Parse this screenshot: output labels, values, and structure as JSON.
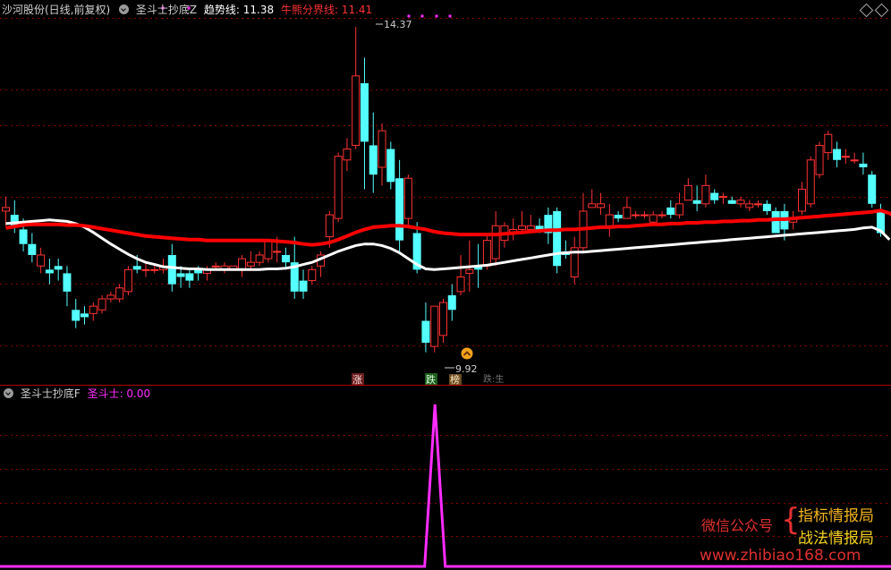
{
  "main_header": {
    "stock": "沙河股份(日线,前复权)",
    "indicator": "圣斗士抄底Z",
    "trend_label": "趋势线: 11.38",
    "bull_bear_label": "牛熊分界线: 11.41"
  },
  "sub_header": {
    "indicator": "圣斗士抄底F",
    "value_label": "圣斗士: 0.00"
  },
  "markers": {
    "high_label": "14.37",
    "low_label": "9.92",
    "rise_badge": "涨",
    "fall_badge": "跌",
    "bang_badge": "榜",
    "fall_badge_partial": "跌:生"
  },
  "watermark": {
    "line1": "微信公众号",
    "line2": "指标情报局",
    "line3": "战法情报局",
    "url": "www.zhibiao168.com"
  },
  "colors": {
    "up": "#ff3232",
    "down": "#54ffff",
    "trend": "#ffffff",
    "bull_bear": "#ff0000",
    "signal": "#ff2cff",
    "grid": "#8b0000",
    "header_text": "#d0d0d0"
  },
  "chart_data": [
    {
      "type": "candlestick",
      "title": "沙河股份(日线,前复权)",
      "series": [
        {
          "name": "趋势线",
          "last_value": 11.38
        },
        {
          "name": "牛熊分界线",
          "last_value": 11.41
        }
      ],
      "annotations": [
        {
          "label": "14.37",
          "kind": "high"
        },
        {
          "label": "9.92",
          "kind": "low"
        }
      ],
      "ohlc": [
        [
          11.85,
          12.05,
          11.65,
          11.9
        ],
        [
          11.8,
          12.0,
          11.55,
          11.63
        ],
        [
          11.6,
          11.75,
          11.3,
          11.4
        ],
        [
          11.4,
          11.55,
          11.15,
          11.25
        ],
        [
          11.1,
          11.35,
          11.0,
          11.25
        ],
        [
          11.05,
          11.2,
          10.85,
          11.0
        ],
        [
          11.1,
          11.2,
          10.9,
          11.05
        ],
        [
          11.0,
          11.1,
          10.55,
          10.75
        ],
        [
          10.5,
          10.65,
          10.25,
          10.35
        ],
        [
          10.45,
          10.55,
          10.3,
          10.4
        ],
        [
          10.45,
          10.6,
          10.35,
          10.55
        ],
        [
          10.5,
          10.7,
          10.45,
          10.65
        ],
        [
          10.65,
          10.75,
          10.6,
          10.7
        ],
        [
          10.65,
          10.85,
          10.6,
          10.8
        ],
        [
          10.75,
          11.1,
          10.7,
          11.05
        ],
        [
          11.1,
          11.25,
          11.0,
          11.05
        ],
        [
          11.05,
          11.15,
          10.95,
          11.05
        ],
        [
          11.05,
          11.1,
          11.0,
          11.05
        ],
        [
          11.05,
          11.2,
          11.0,
          11.1
        ],
        [
          11.25,
          11.4,
          10.75,
          10.85
        ],
        [
          11.0,
          11.1,
          10.8,
          10.95
        ],
        [
          11.0,
          11.05,
          10.8,
          10.9
        ],
        [
          11.05,
          11.1,
          10.9,
          11.0
        ],
        [
          11.0,
          11.1,
          10.9,
          11.05
        ],
        [
          11.1,
          11.15,
          11.05,
          11.1
        ],
        [
          11.05,
          11.15,
          11.0,
          11.1
        ],
        [
          11.05,
          11.1,
          11.05,
          11.1
        ],
        [
          11.05,
          11.25,
          10.95,
          11.2
        ],
        [
          11.1,
          11.3,
          11.05,
          11.15
        ],
        [
          11.15,
          11.3,
          11.1,
          11.25
        ],
        [
          11.2,
          11.45,
          11.15,
          11.45
        ],
        [
          11.3,
          11.5,
          11.15,
          11.3
        ],
        [
          11.25,
          11.35,
          11.05,
          11.15
        ],
        [
          11.15,
          11.5,
          10.65,
          10.75
        ],
        [
          10.9,
          11.05,
          10.65,
          10.75
        ],
        [
          10.9,
          11.1,
          10.85,
          11.05
        ],
        [
          11.1,
          11.3,
          10.95,
          11.25
        ],
        [
          11.5,
          11.85,
          11.35,
          11.8
        ],
        [
          11.75,
          12.65,
          11.7,
          12.6
        ],
        [
          12.55,
          12.85,
          12.4,
          12.7
        ],
        [
          12.75,
          14.37,
          12.7,
          13.7
        ],
        [
          13.6,
          13.95,
          12.15,
          12.8
        ],
        [
          12.75,
          13.2,
          12.1,
          12.35
        ],
        [
          12.45,
          13.05,
          12.2,
          12.95
        ],
        [
          12.7,
          12.8,
          12.15,
          12.25
        ],
        [
          12.3,
          12.55,
          11.3,
          11.45
        ],
        [
          11.75,
          12.35,
          11.65,
          12.3
        ],
        [
          11.55,
          11.7,
          11.0,
          11.05
        ],
        [
          10.35,
          10.6,
          9.92,
          10.05
        ],
        [
          10.0,
          10.55,
          9.92,
          10.55
        ],
        [
          10.15,
          10.65,
          10.05,
          10.6
        ],
        [
          10.7,
          10.85,
          10.35,
          10.5
        ],
        [
          10.75,
          11.25,
          10.7,
          10.95
        ],
        [
          11.0,
          11.45,
          10.75,
          11.05
        ],
        [
          11.1,
          11.4,
          10.8,
          11.05
        ],
        [
          11.1,
          11.55,
          11.05,
          11.45
        ],
        [
          11.2,
          11.85,
          11.1,
          11.65
        ],
        [
          11.45,
          11.7,
          11.35,
          11.65
        ],
        [
          11.55,
          11.75,
          11.45,
          11.6
        ],
        [
          11.6,
          11.85,
          11.55,
          11.65
        ],
        [
          11.6,
          11.8,
          11.55,
          11.65
        ],
        [
          11.65,
          11.75,
          11.55,
          11.6
        ],
        [
          11.8,
          11.9,
          11.4,
          11.55
        ],
        [
          11.85,
          11.9,
          11.0,
          11.1
        ],
        [
          11.3,
          11.45,
          11.2,
          11.25
        ],
        [
          10.95,
          11.5,
          10.85,
          11.35
        ],
        [
          11.35,
          12.1,
          11.3,
          11.85
        ],
        [
          11.9,
          12.15,
          11.9,
          11.95
        ],
        [
          11.9,
          12.1,
          11.8,
          11.95
        ],
        [
          11.65,
          11.95,
          11.5,
          11.8
        ],
        [
          11.8,
          11.85,
          11.7,
          11.75
        ],
        [
          11.75,
          12.05,
          11.75,
          11.9
        ],
        [
          11.8,
          11.85,
          11.75,
          11.8
        ],
        [
          11.8,
          11.85,
          11.75,
          11.8
        ],
        [
          11.7,
          11.85,
          11.65,
          11.8
        ],
        [
          11.8,
          11.85,
          11.75,
          11.8
        ],
        [
          11.9,
          12.0,
          11.75,
          11.8
        ],
        [
          11.8,
          12.1,
          11.75,
          11.95
        ],
        [
          12.0,
          12.3,
          12.0,
          12.2
        ],
        [
          12.0,
          12.2,
          11.85,
          11.95
        ],
        [
          11.95,
          12.35,
          11.9,
          12.2
        ],
        [
          12.1,
          12.15,
          11.95,
          12.0
        ],
        [
          12.05,
          12.1,
          11.95,
          12.05
        ],
        [
          12.0,
          12.05,
          11.95,
          11.95
        ],
        [
          11.95,
          12.05,
          11.9,
          12.0
        ],
        [
          11.9,
          12.0,
          11.85,
          11.95
        ],
        [
          11.95,
          12.0,
          11.9,
          11.95
        ],
        [
          11.95,
          12.0,
          11.8,
          11.85
        ],
        [
          11.85,
          11.9,
          11.55,
          11.55
        ],
        [
          11.85,
          11.95,
          11.45,
          11.6
        ],
        [
          11.7,
          11.85,
          11.6,
          11.75
        ],
        [
          11.85,
          12.25,
          11.8,
          12.15
        ],
        [
          11.95,
          12.6,
          11.9,
          12.55
        ],
        [
          12.35,
          12.8,
          12.3,
          12.75
        ],
        [
          12.65,
          12.95,
          12.55,
          12.9
        ],
        [
          12.7,
          12.8,
          12.45,
          12.55
        ],
        [
          12.6,
          12.7,
          12.5,
          12.6
        ],
        [
          12.55,
          12.65,
          12.5,
          12.55
        ],
        [
          12.5,
          12.65,
          12.35,
          12.45
        ],
        [
          12.35,
          12.4,
          11.9,
          11.95
        ],
        [
          11.85,
          11.95,
          11.5,
          11.55
        ]
      ],
      "trend": [
        11.68,
        11.69,
        11.7,
        11.71,
        11.72,
        11.73,
        11.72,
        11.71,
        11.68,
        11.63,
        11.56,
        11.48,
        11.4,
        11.33,
        11.26,
        11.2,
        11.15,
        11.12,
        11.09,
        11.08,
        11.07,
        11.06,
        11.06,
        11.05,
        11.05,
        11.05,
        11.05,
        11.05,
        11.05,
        11.05,
        11.06,
        11.06,
        11.07,
        11.09,
        11.12,
        11.15,
        11.2,
        11.25,
        11.3,
        11.34,
        11.38,
        11.4,
        11.4,
        11.38,
        11.34,
        11.28,
        11.2,
        11.12,
        11.06,
        11.05,
        11.06,
        11.07,
        11.08,
        11.09,
        11.1,
        11.11,
        11.13,
        11.15,
        11.17,
        11.19,
        11.21,
        11.23,
        11.25,
        11.27,
        11.28,
        11.29,
        11.29,
        11.3,
        11.31,
        11.32,
        11.33,
        11.34,
        11.35,
        11.36,
        11.37,
        11.38,
        11.39,
        11.4,
        11.41,
        11.42,
        11.43,
        11.44,
        11.45,
        11.46,
        11.47,
        11.48,
        11.49,
        11.5,
        11.51,
        11.52,
        11.53,
        11.54,
        11.55,
        11.56,
        11.57,
        11.58,
        11.59,
        11.6,
        11.62,
        11.63,
        11.58,
        11.46
      ],
      "bull_bear": [
        11.62,
        11.64,
        11.66,
        11.67,
        11.67,
        11.67,
        11.67,
        11.66,
        11.66,
        11.65,
        11.63,
        11.61,
        11.59,
        11.57,
        11.55,
        11.53,
        11.51,
        11.5,
        11.49,
        11.48,
        11.47,
        11.46,
        11.46,
        11.45,
        11.45,
        11.45,
        11.45,
        11.45,
        11.45,
        11.45,
        11.45,
        11.44,
        11.43,
        11.42,
        11.4,
        11.39,
        11.4,
        11.42,
        11.46,
        11.51,
        11.56,
        11.6,
        11.63,
        11.64,
        11.65,
        11.65,
        11.64,
        11.62,
        11.6,
        11.57,
        11.55,
        11.54,
        11.53,
        11.53,
        11.53,
        11.53,
        11.53,
        11.54,
        11.55,
        11.56,
        11.57,
        11.58,
        11.59,
        11.59,
        11.6,
        11.6,
        11.61,
        11.62,
        11.63,
        11.63,
        11.64,
        11.64,
        11.65,
        11.66,
        11.67,
        11.67,
        11.68,
        11.68,
        11.69,
        11.69,
        11.7,
        11.7,
        11.71,
        11.71,
        11.72,
        11.72,
        11.73,
        11.73,
        11.74,
        11.74,
        11.75,
        11.76,
        11.77,
        11.78,
        11.79,
        11.8,
        11.81,
        11.82,
        11.83,
        11.84,
        11.86,
        11.82,
        11.74
      ],
      "ylim": [
        9.72,
        14.42
      ]
    },
    {
      "type": "line",
      "series": [
        {
          "name": "圣斗士",
          "values": [
            0,
            0,
            0,
            0,
            0,
            0,
            0,
            0,
            0,
            0,
            0,
            0,
            0,
            0,
            0,
            0,
            0,
            0,
            0,
            0,
            0,
            0,
            0,
            0,
            0,
            0,
            0,
            0,
            0,
            0,
            0,
            0,
            0,
            0,
            0,
            0,
            0,
            0,
            0,
            0,
            0,
            0,
            0,
            0,
            0,
            0,
            0,
            0,
            0,
            0,
            0,
            0,
            0,
            0,
            0,
            0,
            0,
            0,
            0,
            0,
            0,
            0,
            0,
            0,
            0,
            0,
            0,
            0,
            0,
            0,
            0,
            0,
            0,
            0,
            0,
            0,
            0,
            0,
            0,
            0,
            0,
            0,
            0,
            0,
            0,
            0,
            0,
            0,
            0,
            0,
            0,
            0,
            0,
            0,
            0,
            0,
            0,
            0,
            0,
            0,
            0,
            0,
            0
          ]
        }
      ],
      "spike": {
        "index": 49,
        "value": 1
      },
      "ylim": [
        0,
        1
      ]
    }
  ]
}
